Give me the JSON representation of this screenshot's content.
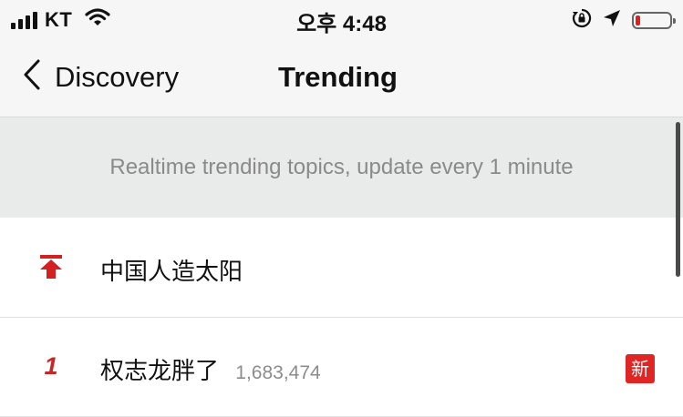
{
  "status_bar": {
    "carrier": "KT",
    "time": "오후 4:48",
    "battery_level": 0.15,
    "battery_color": "#e02020"
  },
  "nav": {
    "back_label": "Discovery",
    "title": "Trending"
  },
  "banner": {
    "text": "Realtime trending topics, update every 1 minute"
  },
  "list": {
    "pinned": {
      "icon": "pin-top-icon",
      "topic": "中国人造太阳"
    },
    "items": [
      {
        "rank": "1",
        "topic": "权志龙胖了",
        "count": "1,683,474",
        "badge": "新"
      }
    ]
  },
  "colors": {
    "accent": "#c62828",
    "badge": "#e02525"
  }
}
